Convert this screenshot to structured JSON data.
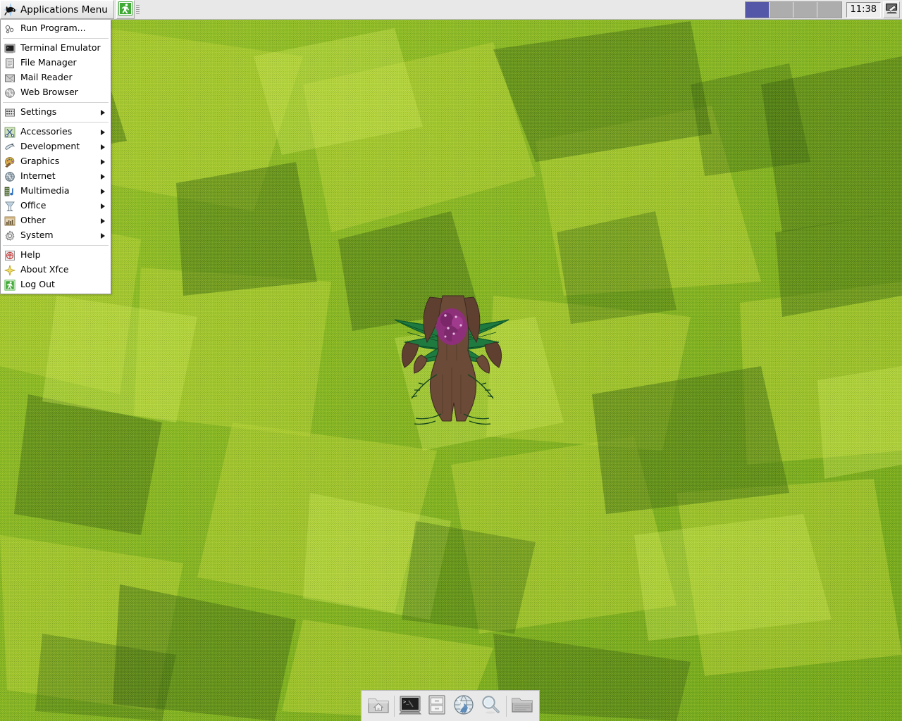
{
  "desktop": {
    "environment": "Xfce",
    "wallpaper": {
      "style": "noisy green polygon mosaic",
      "base_color": "#8ab828",
      "light_color": "#b9d63c",
      "dark_color": "#4e7a18",
      "logo_name": "tree-root-figure-logo",
      "logo_colors": {
        "trunk": "#6b4a38",
        "fronds": "#1f7a3f",
        "flower": "#8e2f7a",
        "flower_highlight": "#e6b8e0"
      }
    }
  },
  "top_panel": {
    "background": "#e8e8e8",
    "applications_menu": {
      "label": "Applications Menu",
      "icon": "xfce-mouse-icon"
    },
    "launchers": [
      {
        "icon": "logout-running-man-icon",
        "name": "log-out-launcher"
      }
    ],
    "handle": {
      "name": "panel-handle",
      "icon": "grip-dots-icon"
    },
    "workspace_switcher": {
      "name": "workspace-switcher",
      "count": 4,
      "active_index": 0,
      "active_color": "#5457a8",
      "inactive_color": "#adadad"
    },
    "clock": {
      "time": "11:38",
      "name": "clock"
    },
    "show_desktop": {
      "icon": "show-desktop-icon",
      "name": "show-desktop-button"
    }
  },
  "applications_menu_popup": {
    "items": [
      {
        "label": "Run Program...",
        "icon": "run-program-icon",
        "submenu": false,
        "name": "menu-item-run-program"
      },
      {
        "separator": true
      },
      {
        "label": "Terminal Emulator",
        "icon": "terminal-icon",
        "submenu": false,
        "name": "menu-item-terminal-emulator"
      },
      {
        "label": "File Manager",
        "icon": "file-manager-icon",
        "submenu": false,
        "name": "menu-item-file-manager"
      },
      {
        "label": "Mail Reader",
        "icon": "mail-reader-icon",
        "submenu": false,
        "name": "menu-item-mail-reader"
      },
      {
        "label": "Web Browser",
        "icon": "web-browser-icon",
        "submenu": false,
        "name": "menu-item-web-browser"
      },
      {
        "separator": true
      },
      {
        "label": "Settings",
        "icon": "settings-icon",
        "submenu": true,
        "name": "menu-item-settings"
      },
      {
        "separator": true
      },
      {
        "label": "Accessories",
        "icon": "accessories-icon",
        "submenu": true,
        "name": "menu-item-accessories"
      },
      {
        "label": "Development",
        "icon": "development-icon",
        "submenu": true,
        "name": "menu-item-development"
      },
      {
        "label": "Graphics",
        "icon": "graphics-icon",
        "submenu": true,
        "name": "menu-item-graphics"
      },
      {
        "label": "Internet",
        "icon": "internet-globe-icon",
        "submenu": true,
        "name": "menu-item-internet"
      },
      {
        "label": "Multimedia",
        "icon": "multimedia-icon",
        "submenu": true,
        "name": "menu-item-multimedia"
      },
      {
        "label": "Office",
        "icon": "office-icon",
        "submenu": true,
        "name": "menu-item-office"
      },
      {
        "label": "Other",
        "icon": "other-icon",
        "submenu": true,
        "name": "menu-item-other"
      },
      {
        "label": "System",
        "icon": "system-gear-icon",
        "submenu": true,
        "name": "menu-item-system"
      },
      {
        "separator": true
      },
      {
        "label": "Help",
        "icon": "help-icon",
        "submenu": false,
        "name": "menu-item-help"
      },
      {
        "label": "About Xfce",
        "icon": "about-xfce-star-icon",
        "submenu": false,
        "name": "menu-item-about-xfce"
      },
      {
        "label": "Log Out",
        "icon": "logout-running-man-icon",
        "submenu": false,
        "name": "menu-item-log-out"
      }
    ]
  },
  "dock": {
    "items": [
      {
        "icon": "home-folder-icon",
        "name": "dock-item-home-folder"
      },
      {
        "separator": true
      },
      {
        "icon": "terminal-icon",
        "name": "dock-item-terminal"
      },
      {
        "icon": "file-manager-cabinet-icon",
        "name": "dock-item-file-manager"
      },
      {
        "icon": "web-browser-globe-icon",
        "name": "dock-item-web-browser"
      },
      {
        "icon": "find-magnifier-icon",
        "name": "dock-item-find-files"
      },
      {
        "separator": true
      },
      {
        "icon": "trash-folder-icon",
        "name": "dock-item-trash"
      }
    ]
  }
}
